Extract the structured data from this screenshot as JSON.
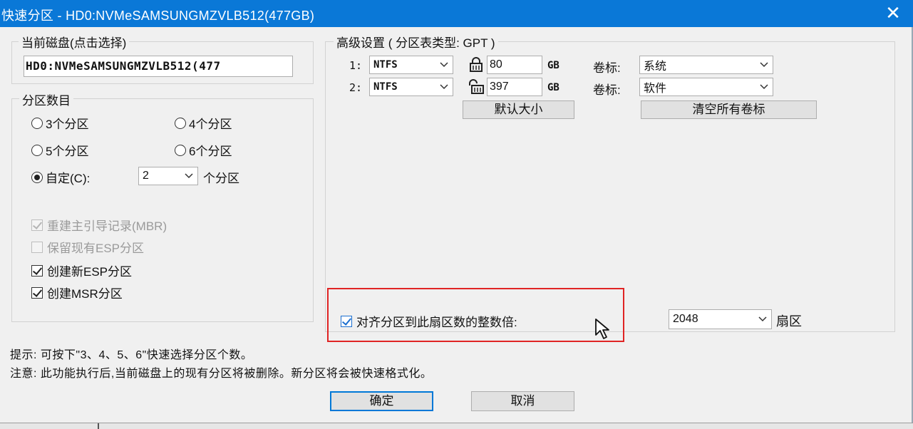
{
  "window": {
    "title": "快速分区 - HD0:NVMeSAMSUNGMZVLB512(477GB)",
    "close_glyph": "✕"
  },
  "current_disk": {
    "legend": "当前磁盘(点击选择)",
    "value": "HD0:NVMeSAMSUNGMZVLB512(477"
  },
  "partition_count": {
    "legend": "分区数目",
    "options": [
      "3个分区",
      "4个分区",
      "5个分区",
      "6个分区"
    ],
    "custom_label": "自定(C):",
    "custom_value": "2",
    "custom_suffix": "个分区",
    "selected": "自定(C):"
  },
  "options": {
    "rebuild_mbr": "重建主引导记录(MBR)",
    "keep_esp": "保留现有ESP分区",
    "create_esp": "创建新ESP分区",
    "create_msr": "创建MSR分区"
  },
  "advanced": {
    "legend": "高级设置 ( 分区表类型: GPT )",
    "partitions": [
      {
        "index": "1:",
        "fs": "NTFS",
        "size": "80",
        "unit": "GB",
        "label_caption": "卷标:",
        "label": "系统",
        "lock": "locked"
      },
      {
        "index": "2:",
        "fs": "NTFS",
        "size": "397",
        "unit": "GB",
        "label_caption": "卷标:",
        "label": "软件",
        "lock": "unlocked"
      }
    ],
    "default_size_button": "默认大小",
    "clear_labels_button": "清空所有卷标",
    "align_label": "对齐分区到此扇区数的整数倍:",
    "align_value": "2048",
    "sector_unit": "扇区"
  },
  "hints": {
    "tip": "提示: 可按下\"3、4、5、6\"快速选择分区个数。",
    "warning": "注意: 此功能执行后,当前磁盘上的现有分区将被删除。新分区将会被快速格式化。"
  },
  "buttons": {
    "ok": "确定",
    "cancel": "取消"
  },
  "colors": {
    "titlebar": "#0a78d7",
    "highlight_box": "#e02424",
    "default_button_border": "#0078d7"
  }
}
